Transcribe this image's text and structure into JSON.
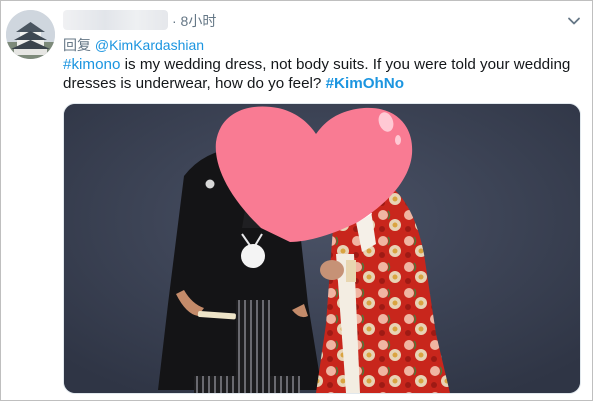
{
  "tweet": {
    "time": "· 8小时",
    "reply": {
      "prefix": "回复",
      "mention": "@KimKardashian"
    },
    "text": {
      "hashtag1": "#kimono",
      "body": " is my wedding dress, not body suits.  If you were told your wedding dresses is underwear, how do yo feel? ",
      "hashtag2": "#KimOhNo"
    },
    "icons": {
      "avatar": "castle-avatar",
      "menu": "chevron-down-icon",
      "redaction": "heart-sticker"
    },
    "colors": {
      "link": "#1b95e0",
      "text": "#14171a",
      "meta": "#657786",
      "sticker": "#f97b93"
    }
  }
}
